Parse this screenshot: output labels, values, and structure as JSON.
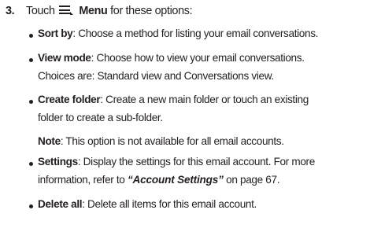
{
  "step": {
    "number": "3.",
    "touch": "Touch",
    "menu_label": "Menu",
    "rest": "for these options:"
  },
  "items": [
    {
      "term": "Sort by",
      "lines": [
        ": Choose a method for listing your email conversations."
      ]
    },
    {
      "term": "View mode",
      "lines": [
        ": Choose how to view your email conversations.",
        "Choices are: Standard view and Conversations view."
      ]
    },
    {
      "term": "Create folder",
      "lines": [
        ": Create a new main folder or touch an existing",
        "folder to create a sub-folder."
      ]
    },
    {
      "term": "Settings",
      "lines": [
        ": Display the settings for this email account. For more",
        "information, refer to"
      ],
      "xref": "“Account Settings”",
      "page_ref": " on page 67."
    },
    {
      "term": "Delete all",
      "lines": [
        ": Delete all items for this email account."
      ]
    }
  ],
  "note": {
    "label": "Note",
    "text": ": This option is not available for all email accounts."
  }
}
